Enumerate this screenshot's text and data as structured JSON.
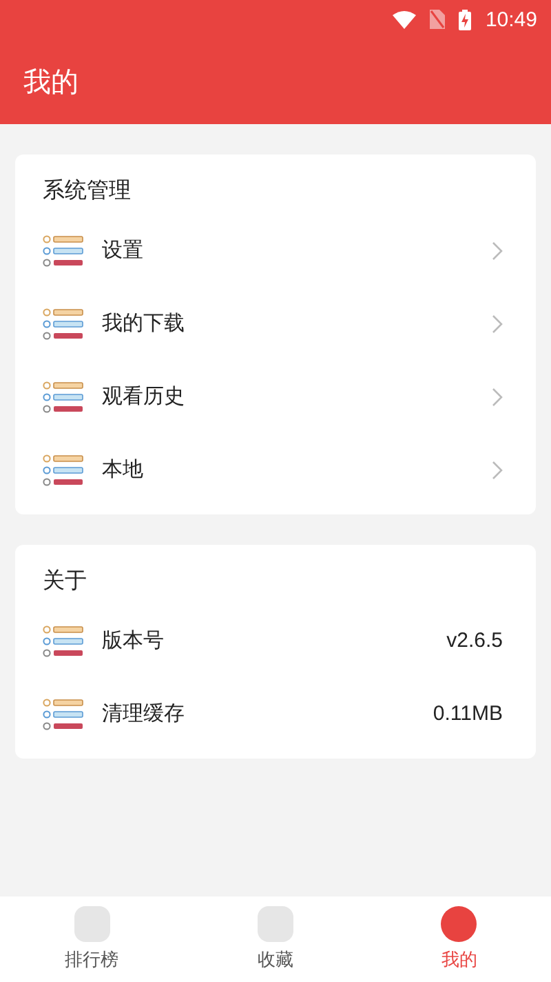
{
  "status_bar": {
    "time": "10:49"
  },
  "header": {
    "title": "我的"
  },
  "sections": [
    {
      "title": "系统管理",
      "rows": [
        {
          "kind": "link",
          "label": "设置"
        },
        {
          "kind": "link",
          "label": "我的下载"
        },
        {
          "kind": "link",
          "label": "观看历史"
        },
        {
          "kind": "link",
          "label": "本地"
        }
      ]
    },
    {
      "title": "关于",
      "rows": [
        {
          "kind": "value",
          "label": "版本号",
          "value": "v2.6.5"
        },
        {
          "kind": "value",
          "label": "清理缓存",
          "value": "0.11MB"
        }
      ]
    }
  ],
  "tabs": [
    {
      "label": "排行榜",
      "selected": false
    },
    {
      "label": "收藏",
      "selected": false
    },
    {
      "label": "我的",
      "selected": true
    }
  ]
}
